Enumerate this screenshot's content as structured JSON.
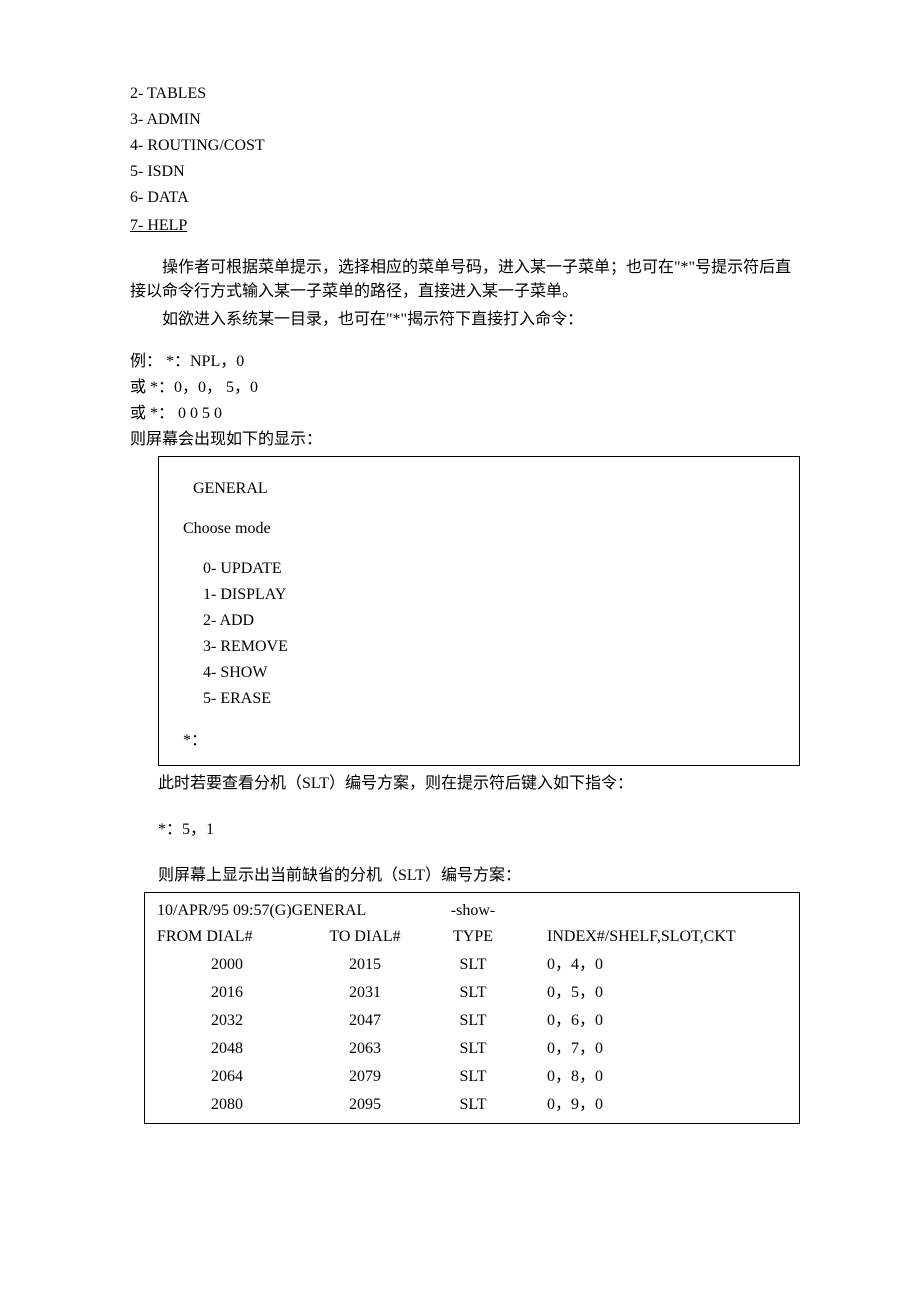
{
  "top_menu": {
    "items": [
      "2-  TABLES",
      "3-  ADMIN",
      "4-  ROUTING/COST",
      "5-  ISDN",
      "6-  DATA",
      "7-  HELP"
    ]
  },
  "para1": "操作者可根据菜单提示，选择相应的菜单号码，进入某一子菜单；也可在\"*\"号提示符后直接以命令行方式输入某一子菜单的路径，直接进入某一子菜单。",
  "para2": "如欲进入系统某一目录，也可在\"*\"揭示符下直接打入命令：",
  "ex_lines": [
    "例：  *：NPL，0",
    "或  *：0，0，  5，0",
    "或  *：  0 0 5 0",
    "则屏幕会出现如下的显示："
  ],
  "box1": {
    "title": "GENERAL",
    "subtitle": "Choose mode",
    "options": [
      "0-   UPDATE",
      "1-   DISPLAY",
      "2-   ADD",
      "3-   REMOVE",
      "4-   SHOW",
      "5-   ERASE"
    ],
    "star": "*："
  },
  "after_box": "此时若要查看分机（SLT）编号方案，则在提示符后键入如下指令：",
  "cmd": "*：5，1",
  "before_table": "则屏幕上显示出当前缺省的分机（SLT）编号方案：",
  "table": {
    "header_line1_left": "10/APR/95 09:57(G)GENERAL",
    "header_line1_mid": "-show-",
    "h_from": "FROM DIAL#",
    "h_to": "TO DIAL#",
    "h_type": "TYPE",
    "h_index": "INDEX#/SHELF,SLOT,CKT",
    "rows": [
      {
        "from": "2000",
        "to": "2015",
        "type": "SLT",
        "index": "0，4，0"
      },
      {
        "from": "2016",
        "to": "2031",
        "type": "SLT",
        "index": "0，5，0"
      },
      {
        "from": "2032",
        "to": "2047",
        "type": "SLT",
        "index": "0，6，0"
      },
      {
        "from": "2048",
        "to": "2063",
        "type": "SLT",
        "index": "0，7，0"
      },
      {
        "from": "2064",
        "to": "2079",
        "type": "SLT",
        "index": "0，8，0"
      },
      {
        "from": "2080",
        "to": "2095",
        "type": "SLT",
        "index": "0，9，0"
      }
    ]
  }
}
